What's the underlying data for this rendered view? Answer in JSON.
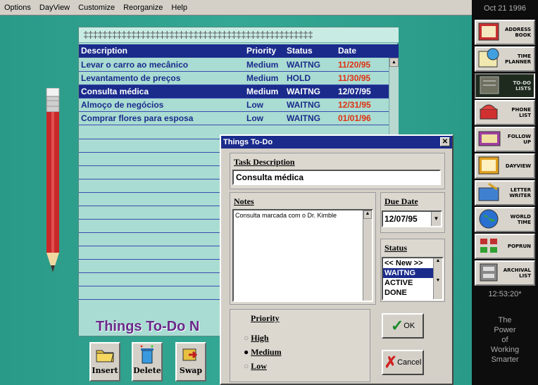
{
  "menu": [
    "Options",
    "DayView",
    "Customize",
    "Reorganize",
    "Help"
  ],
  "sidebar": {
    "date": "Oct 21 1996",
    "items": [
      {
        "label": "ADDRESS BOOK",
        "icon": "address-book-icon"
      },
      {
        "label": "TIME PLANNER",
        "icon": "time-planner-icon"
      },
      {
        "label": "TO-DO LISTS",
        "icon": "todo-list-icon"
      },
      {
        "label": "PHONE LIST",
        "icon": "phone-list-icon"
      },
      {
        "label": "FOLLOW UP",
        "icon": "follow-up-icon"
      },
      {
        "label": "DAYVIEW",
        "icon": "dayview-icon"
      },
      {
        "label": "LETTER WRITER",
        "icon": "letter-writer-icon"
      },
      {
        "label": "WORLD TIME",
        "icon": "world-time-icon"
      },
      {
        "label": "POPRUN",
        "icon": "poprun-icon"
      },
      {
        "label": "ARCHIVAL LIST",
        "icon": "archival-list-icon"
      }
    ],
    "time": "12:53:20*",
    "tagline": [
      "The",
      "Power",
      "of",
      "Working",
      "Smarter"
    ]
  },
  "notepad": {
    "headers": {
      "description": "Description",
      "priority": "Priority",
      "status": "Status",
      "date": "Date"
    },
    "rows": [
      {
        "description": "Levar o carro ao mecânico",
        "priority": "Medium",
        "status": "WAITNG",
        "date": "11/20/95"
      },
      {
        "description": "Levantamento de preços",
        "priority": "Medium",
        "status": "HOLD",
        "date": "11/30/95"
      },
      {
        "description": "Consulta médica",
        "priority": "Medium",
        "status": "WAITNG",
        "date": "12/07/95"
      },
      {
        "description": "Almoço de negócios",
        "priority": "Low",
        "status": "WAITNG",
        "date": "12/31/95"
      },
      {
        "description": "Comprar flores para esposa",
        "priority": "Low",
        "status": "WAITNG",
        "date": "01/01/96"
      }
    ],
    "selected_row": 2,
    "title": "Things To-Do N"
  },
  "buttons": {
    "insert": "Insert",
    "delete": "Delete",
    "swap": "Swap"
  },
  "dialog": {
    "title": "Things To-Do",
    "task_label": "Task Description",
    "task_value": "Consulta médica",
    "notes_label": "Notes",
    "notes_value": "Consulta marcada com o Dr. Kimble",
    "due_label": "Due Date",
    "due_value": "12/07/95",
    "status_label": "Status",
    "status_options": [
      "<< New >>",
      "WAITNG",
      "ACTIVE",
      "DONE"
    ],
    "status_selected": "WAITNG",
    "priority_label": "Priority",
    "priority_options": [
      "High",
      "Medium",
      "Low"
    ],
    "priority_selected": "Medium",
    "ok_label": "OK",
    "cancel_label": "Cancel"
  }
}
